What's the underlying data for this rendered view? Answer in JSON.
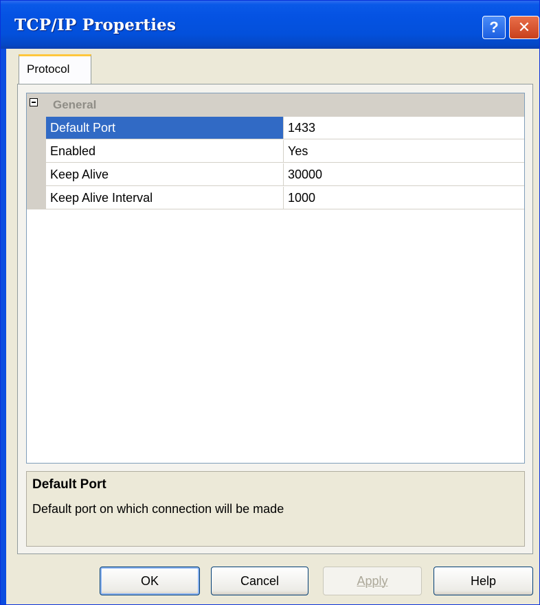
{
  "window": {
    "title": "TCP/IP Properties",
    "help_label": "?",
    "close_label": "✕"
  },
  "tabs": [
    {
      "label": "Protocol",
      "selected": true
    }
  ],
  "property_grid": {
    "category": {
      "label": "General",
      "expanded": true,
      "expander_symbol": "−"
    },
    "rows": [
      {
        "name": "Default Port",
        "value": "1433",
        "selected": true
      },
      {
        "name": "Enabled",
        "value": "Yes",
        "selected": false
      },
      {
        "name": "Keep Alive",
        "value": "30000",
        "selected": false
      },
      {
        "name": "Keep Alive Interval",
        "value": "1000",
        "selected": false
      }
    ]
  },
  "description": {
    "title": "Default Port",
    "text": "Default port on which connection will be made"
  },
  "buttons": {
    "ok": "OK",
    "cancel": "Cancel",
    "apply": "Apply",
    "help": "Help"
  },
  "colors": {
    "titlebar": "#0553e3",
    "selection": "#316ac5",
    "tab_highlight": "#ffc73c"
  }
}
